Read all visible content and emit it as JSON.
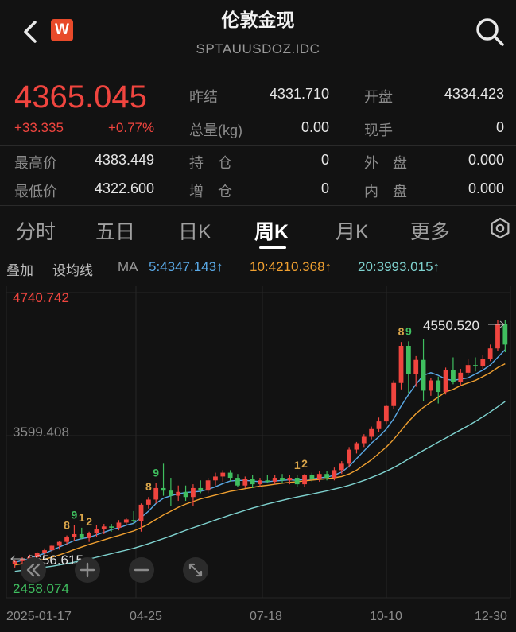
{
  "header": {
    "title": "伦敦金现",
    "subtitle": "SPTAUUSDOZ.IDC",
    "logo_text": "W",
    "icons": {
      "back": "back-arrow-icon",
      "search": "search-icon"
    }
  },
  "quote": {
    "price": "4365.045",
    "change": "+33.335",
    "change_pct": "+0.77%",
    "fields": [
      {
        "label": "昨结",
        "value": "4331.710"
      },
      {
        "label": "开盘",
        "value": "4334.423"
      },
      {
        "label": "总量(kg)",
        "value": "0.00"
      },
      {
        "label": "现手",
        "value": "0"
      },
      {
        "label": "最高价",
        "value": "4383.449"
      },
      {
        "label": "持　仓",
        "value": "0"
      },
      {
        "label": "外　盘",
        "value": "0.000"
      },
      {
        "label": "最低价",
        "value": "4322.600"
      },
      {
        "label": "增　仓",
        "value": "0"
      },
      {
        "label": "内　盘",
        "value": "0.000"
      }
    ]
  },
  "tabs": [
    {
      "label": "分时",
      "active": false
    },
    {
      "label": "五日",
      "active": false
    },
    {
      "label": "日K",
      "active": false
    },
    {
      "label": "周K",
      "active": true
    },
    {
      "label": "月K",
      "active": false
    },
    {
      "label": "更多",
      "active": false
    }
  ],
  "indicators": {
    "overlay": "叠加",
    "set_ma": "设均线",
    "ma_label": "MA",
    "ma5": "5:4347.143↑",
    "ma10": "10:4210.368↑",
    "ma20": "20:3993.015↑"
  },
  "colors": {
    "up": "#f0453f",
    "down": "#3fbf5f",
    "ma5": "#5aa9e6",
    "ma10": "#f0a030",
    "ma20": "#7fd3d0",
    "td_label": "#d9a54a",
    "td_label_down": "#3fbf5f"
  },
  "chart_data": {
    "type": "candlestick",
    "title": "",
    "ymax_label": "4740.742",
    "ymid_label": "3599.408",
    "ymin_label": "2458.074",
    "ylim": [
      2458.074,
      4740.742
    ],
    "high_annotation": "4550.520",
    "low_annotation": "2656.615",
    "x_ticks": [
      "2025-01-17",
      "04-25",
      "07-18",
      "10-10",
      "12-30"
    ],
    "candles": [
      {
        "o": 2650,
        "h": 2680,
        "l": 2620,
        "c": 2670
      },
      {
        "o": 2670,
        "h": 2700,
        "l": 2640,
        "c": 2685
      },
      {
        "o": 2680,
        "h": 2720,
        "l": 2650,
        "c": 2700
      },
      {
        "o": 2700,
        "h": 2740,
        "l": 2680,
        "c": 2735
      },
      {
        "o": 2735,
        "h": 2770,
        "l": 2710,
        "c": 2755
      },
      {
        "o": 2755,
        "h": 2800,
        "l": 2730,
        "c": 2790
      },
      {
        "o": 2790,
        "h": 2830,
        "l": 2760,
        "c": 2820
      },
      {
        "o": 2820,
        "h": 2870,
        "l": 2800,
        "c": 2855
      },
      {
        "o": 2855,
        "h": 2950,
        "l": 2830,
        "c": 2880
      },
      {
        "o": 2880,
        "h": 2930,
        "l": 2840,
        "c": 2850
      },
      {
        "o": 2850,
        "h": 2900,
        "l": 2820,
        "c": 2890
      },
      {
        "o": 2890,
        "h": 2950,
        "l": 2860,
        "c": 2920
      },
      {
        "o": 2920,
        "h": 2960,
        "l": 2880,
        "c": 2940
      },
      {
        "o": 2940,
        "h": 2960,
        "l": 2900,
        "c": 2930
      },
      {
        "o": 2930,
        "h": 2990,
        "l": 2910,
        "c": 2970
      },
      {
        "o": 2970,
        "h": 3010,
        "l": 2950,
        "c": 2995
      },
      {
        "o": 2990,
        "h": 3060,
        "l": 2960,
        "c": 2985
      },
      {
        "o": 2985,
        "h": 3120,
        "l": 2900,
        "c": 3110
      },
      {
        "o": 3110,
        "h": 3170,
        "l": 3080,
        "c": 3150
      },
      {
        "o": 3150,
        "h": 3280,
        "l": 3120,
        "c": 3240
      },
      {
        "o": 3240,
        "h": 3430,
        "l": 3180,
        "c": 3220
      },
      {
        "o": 3220,
        "h": 3320,
        "l": 3100,
        "c": 3180
      },
      {
        "o": 3180,
        "h": 3260,
        "l": 3140,
        "c": 3210
      },
      {
        "o": 3210,
        "h": 3260,
        "l": 3140,
        "c": 3170
      },
      {
        "o": 3170,
        "h": 3270,
        "l": 3100,
        "c": 3240
      },
      {
        "o": 3240,
        "h": 3300,
        "l": 3200,
        "c": 3220
      },
      {
        "o": 3220,
        "h": 3320,
        "l": 3200,
        "c": 3300
      },
      {
        "o": 3300,
        "h": 3360,
        "l": 3260,
        "c": 3330
      },
      {
        "o": 3330,
        "h": 3380,
        "l": 3290,
        "c": 3360
      },
      {
        "o": 3360,
        "h": 3380,
        "l": 3290,
        "c": 3320
      },
      {
        "o": 3320,
        "h": 3350,
        "l": 3250,
        "c": 3260
      },
      {
        "o": 3260,
        "h": 3330,
        "l": 3240,
        "c": 3310
      },
      {
        "o": 3310,
        "h": 3340,
        "l": 3240,
        "c": 3270
      },
      {
        "o": 3270,
        "h": 3320,
        "l": 3250,
        "c": 3300
      },
      {
        "o": 3300,
        "h": 3340,
        "l": 3280,
        "c": 3290
      },
      {
        "o": 3290,
        "h": 3340,
        "l": 3270,
        "c": 3320
      },
      {
        "o": 3320,
        "h": 3350,
        "l": 3280,
        "c": 3300
      },
      {
        "o": 3300,
        "h": 3340,
        "l": 3270,
        "c": 3320
      },
      {
        "o": 3320,
        "h": 3340,
        "l": 3250,
        "c": 3270
      },
      {
        "o": 3270,
        "h": 3350,
        "l": 3250,
        "c": 3340
      },
      {
        "o": 3340,
        "h": 3360,
        "l": 3290,
        "c": 3310
      },
      {
        "o": 3310,
        "h": 3370,
        "l": 3290,
        "c": 3350
      },
      {
        "o": 3350,
        "h": 3370,
        "l": 3300,
        "c": 3320
      },
      {
        "o": 3320,
        "h": 3400,
        "l": 3300,
        "c": 3380
      },
      {
        "o": 3380,
        "h": 3450,
        "l": 3350,
        "c": 3430
      },
      {
        "o": 3430,
        "h": 3560,
        "l": 3400,
        "c": 3540
      },
      {
        "o": 3540,
        "h": 3600,
        "l": 3510,
        "c": 3590
      },
      {
        "o": 3590,
        "h": 3660,
        "l": 3560,
        "c": 3640
      },
      {
        "o": 3640,
        "h": 3720,
        "l": 3620,
        "c": 3700
      },
      {
        "o": 3700,
        "h": 3790,
        "l": 3680,
        "c": 3760
      },
      {
        "o": 3760,
        "h": 3890,
        "l": 3740,
        "c": 3880
      },
      {
        "o": 3880,
        "h": 4080,
        "l": 3860,
        "c": 4060
      },
      {
        "o": 4060,
        "h": 4380,
        "l": 4010,
        "c": 4350
      },
      {
        "o": 4350,
        "h": 4385,
        "l": 3980,
        "c": 4130
      },
      {
        "o": 4130,
        "h": 4270,
        "l": 4030,
        "c": 4240
      },
      {
        "o": 4240,
        "h": 4400,
        "l": 3920,
        "c": 4000
      },
      {
        "o": 4000,
        "h": 4100,
        "l": 3960,
        "c": 4080
      },
      {
        "o": 4080,
        "h": 4110,
        "l": 3900,
        "c": 3990
      },
      {
        "o": 3990,
        "h": 4180,
        "l": 3970,
        "c": 4160
      },
      {
        "o": 4160,
        "h": 4260,
        "l": 4050,
        "c": 4070
      },
      {
        "o": 4070,
        "h": 4170,
        "l": 4040,
        "c": 4140
      },
      {
        "o": 4140,
        "h": 4250,
        "l": 4120,
        "c": 4200
      },
      {
        "o": 4200,
        "h": 4260,
        "l": 4150,
        "c": 4190
      },
      {
        "o": 4190,
        "h": 4280,
        "l": 4170,
        "c": 4250
      },
      {
        "o": 4250,
        "h": 4360,
        "l": 4230,
        "c": 4330
      },
      {
        "o": 4330,
        "h": 4550,
        "l": 4310,
        "c": 4520
      },
      {
        "o": 4520,
        "h": 4550,
        "l": 4300,
        "c": 4360
      }
    ],
    "series": [
      {
        "name": "MA5",
        "values": [
          2660,
          2675,
          2690,
          2710,
          2730,
          2755,
          2780,
          2805,
          2830,
          2845,
          2855,
          2875,
          2895,
          2915,
          2930,
          2950,
          2965,
          3010,
          3060,
          3120,
          3160,
          3180,
          3195,
          3205,
          3210,
          3215,
          3230,
          3250,
          3275,
          3295,
          3300,
          3300,
          3295,
          3290,
          3290,
          3295,
          3300,
          3305,
          3300,
          3310,
          3310,
          3320,
          3325,
          3340,
          3365,
          3410,
          3470,
          3530,
          3590,
          3640,
          3700,
          3780,
          3880,
          3970,
          4050,
          4120,
          4140,
          4120,
          4090,
          4080,
          4090,
          4100,
          4130,
          4160,
          4200,
          4260,
          4320
        ]
      },
      {
        "name": "MA10",
        "values": [
          2640,
          2650,
          2660,
          2672,
          2685,
          2700,
          2718,
          2738,
          2760,
          2780,
          2800,
          2818,
          2836,
          2854,
          2870,
          2888,
          2905,
          2930,
          2960,
          2995,
          3030,
          3060,
          3090,
          3115,
          3135,
          3155,
          3170,
          3185,
          3200,
          3215,
          3225,
          3235,
          3245,
          3255,
          3262,
          3270,
          3278,
          3285,
          3290,
          3296,
          3302,
          3308,
          3313,
          3320,
          3330,
          3350,
          3380,
          3420,
          3460,
          3510,
          3560,
          3620,
          3690,
          3760,
          3820,
          3870,
          3910,
          3950,
          3990,
          4010,
          4040,
          4060,
          4080,
          4110,
          4140,
          4180,
          4210
        ]
      },
      {
        "name": "MA20",
        "values": [
          2590,
          2598,
          2606,
          2614,
          2622,
          2630,
          2640,
          2650,
          2662,
          2674,
          2686,
          2700,
          2714,
          2728,
          2742,
          2756,
          2770,
          2788,
          2806,
          2826,
          2846,
          2866,
          2888,
          2910,
          2930,
          2950,
          2970,
          2990,
          3010,
          3030,
          3048,
          3066,
          3084,
          3100,
          3116,
          3130,
          3144,
          3158,
          3170,
          3182,
          3194,
          3206,
          3218,
          3232,
          3246,
          3262,
          3280,
          3300,
          3322,
          3346,
          3372,
          3400,
          3432,
          3466,
          3500,
          3534,
          3566,
          3598,
          3630,
          3662,
          3694,
          3726,
          3760,
          3796,
          3834,
          3874,
          3915
        ]
      }
    ],
    "td_marks": [
      {
        "index": 7,
        "label": "8",
        "color": "up"
      },
      {
        "index": 8,
        "label": "9",
        "color": "down"
      },
      {
        "index": 9,
        "label": "1",
        "color": "up"
      },
      {
        "index": 10,
        "label": "2",
        "color": "up"
      },
      {
        "index": 18,
        "label": "8",
        "color": "up"
      },
      {
        "index": 19,
        "label": "9",
        "color": "down"
      },
      {
        "index": 38,
        "label": "1",
        "color": "up"
      },
      {
        "index": 39,
        "label": "2",
        "color": "up"
      },
      {
        "index": 52,
        "label": "8",
        "color": "up"
      },
      {
        "index": 53,
        "label": "9",
        "color": "down"
      }
    ]
  },
  "controls": {
    "icons": [
      "double-left-icon",
      "zoom-in-icon",
      "zoom-out-icon",
      "fullscreen-icon"
    ]
  }
}
